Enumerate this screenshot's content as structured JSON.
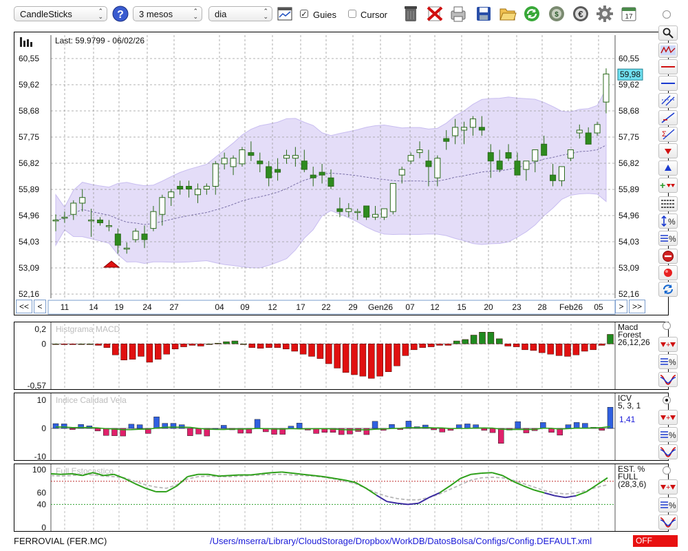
{
  "toolbar": {
    "chart_type": "CandleSticks",
    "period": "3 mesos",
    "interval": "dia",
    "guies_label": "Guies",
    "guies_checked": true,
    "cursor_label": "Cursor",
    "cursor_checked": false,
    "icons": [
      "help-icon",
      "grid-icon",
      "trash-icon",
      "delete-icon",
      "print-icon",
      "save-icon",
      "open-folder-icon",
      "refresh-icon",
      "money-icon",
      "euro-icon",
      "settings-icon",
      "calendar-icon"
    ],
    "calendar_day": "17"
  },
  "main_chart": {
    "last_label": "Last: 59.9799 - 06/02/26",
    "last_price": "59,98",
    "y_ticks": [
      "60,55",
      "59,62",
      "58,68",
      "57,75",
      "56,82",
      "55,89",
      "54,96",
      "54,03",
      "53,09",
      "52,16"
    ],
    "x_ticks": [
      "11",
      "14",
      "19",
      "24",
      "27",
      "04",
      "09",
      "12",
      "17",
      "22",
      "29",
      "Gen26",
      "07",
      "12",
      "15",
      "20",
      "23",
      "28",
      "Feb26",
      "05"
    ],
    "nav": {
      "first": "<<",
      "prev": "<",
      "next": ">",
      "last": ">>"
    }
  },
  "macd": {
    "title": "Histgrama MACD",
    "y_ticks": [
      "0,2",
      "0",
      "-0,57"
    ],
    "label_lines": [
      "Macd",
      "Forest",
      "26,12,26"
    ]
  },
  "icv": {
    "title": "Indice Calidad Vela",
    "y_ticks": [
      "10",
      "0",
      "-10"
    ],
    "label_lines": [
      "ICV",
      "5, 3, 1"
    ],
    "value": "1,41"
  },
  "stoch": {
    "title": "Full Estocastico",
    "y_ticks": [
      "100",
      "60",
      "40",
      "0"
    ],
    "label_lines": [
      "EST. %",
      "FULL",
      "(28,3,6)"
    ]
  },
  "status": {
    "ticker": "FERROVIAL (FER.MC)",
    "config_path": "/Users/mserra/Library/CloudStorage/Dropbox/WorkDB/DatosBolsa/Configs/Config.DEFAULT.xml",
    "state": "OFF"
  },
  "colors": {
    "up_candle": "#2e8b1e",
    "down_candle": "#2e8b1e",
    "band_fill": "#e4ddf8",
    "macd_bar": "#e01010",
    "macd_pos": "#208a20",
    "icv_pos": "#3060e0",
    "icv_neg": "#e0206a",
    "line_green": "#2ea01a",
    "line_blue": "#3a2aa0",
    "line_gray": "#b8b8b8",
    "status_off": "#e81010"
  },
  "chart_data": [
    {
      "type": "candlestick",
      "ylim": [
        52.16,
        60.55
      ],
      "candles": [
        [
          54.8,
          55.0,
          54.4,
          54.8
        ],
        [
          54.9,
          55.1,
          54.7,
          54.9
        ],
        [
          55.0,
          55.5,
          54.8,
          55.4
        ],
        [
          55.4,
          55.9,
          55.1,
          55.6
        ],
        [
          54.8,
          55.2,
          54.2,
          54.8
        ],
        [
          54.8,
          54.9,
          54.6,
          54.7
        ],
        [
          54.6,
          54.8,
          54.4,
          54.6
        ],
        [
          54.3,
          54.5,
          53.6,
          53.9
        ],
        [
          53.8,
          54.0,
          53.6,
          53.8
        ],
        [
          54.1,
          54.5,
          54.0,
          54.4
        ],
        [
          54.3,
          54.6,
          53.8,
          54.1
        ],
        [
          54.5,
          55.3,
          54.4,
          55.1
        ],
        [
          55.0,
          55.7,
          54.6,
          55.6
        ],
        [
          55.6,
          55.9,
          55.3,
          55.8
        ],
        [
          56.0,
          56.2,
          55.7,
          55.9
        ],
        [
          56.0,
          56.2,
          55.6,
          55.9
        ],
        [
          55.7,
          56.1,
          55.4,
          55.9
        ],
        [
          55.9,
          56.1,
          55.7,
          56.0
        ],
        [
          56.0,
          56.9,
          55.7,
          56.8
        ],
        [
          56.8,
          57.2,
          56.6,
          57.0
        ],
        [
          56.7,
          57.1,
          56.4,
          57.0
        ],
        [
          56.8,
          57.4,
          56.7,
          57.3
        ],
        [
          57.2,
          57.6,
          56.9,
          57.1
        ],
        [
          56.9,
          57.2,
          56.5,
          56.8
        ],
        [
          56.7,
          56.9,
          56.0,
          56.3
        ],
        [
          56.6,
          57.0,
          56.2,
          56.5
        ],
        [
          57.0,
          57.3,
          56.8,
          57.1
        ],
        [
          57.0,
          57.4,
          56.7,
          57.1
        ],
        [
          56.9,
          57.3,
          56.5,
          56.6
        ],
        [
          56.4,
          56.7,
          56.0,
          56.3
        ],
        [
          56.5,
          56.8,
          56.1,
          56.4
        ],
        [
          56.3,
          56.6,
          55.9,
          56.0
        ],
        [
          55.2,
          55.6,
          54.9,
          55.1
        ],
        [
          55.1,
          55.4,
          54.9,
          55.2
        ],
        [
          55.1,
          55.2,
          54.8,
          55.1
        ],
        [
          55.3,
          55.3,
          54.8,
          54.9
        ],
        [
          54.9,
          55.3,
          54.8,
          55.0
        ],
        [
          54.9,
          55.2,
          54.8,
          55.2
        ],
        [
          55.1,
          56.0,
          55.0,
          56.1
        ],
        [
          56.4,
          56.7,
          56.1,
          56.6
        ],
        [
          56.9,
          57.2,
          56.8,
          57.1
        ],
        [
          57.2,
          57.6,
          57.0,
          57.3
        ],
        [
          56.9,
          57.3,
          56.0,
          56.7
        ],
        [
          56.3,
          57.1,
          56.0,
          57.0
        ],
        [
          57.7,
          58.0,
          57.3,
          57.6
        ],
        [
          57.8,
          58.4,
          57.5,
          58.1
        ],
        [
          58.0,
          58.3,
          57.5,
          58.1
        ],
        [
          58.1,
          58.5,
          57.8,
          58.4
        ],
        [
          58.1,
          58.5,
          57.8,
          58.0
        ],
        [
          57.2,
          57.5,
          56.3,
          56.9
        ],
        [
          56.9,
          57.3,
          56.5,
          56.6
        ],
        [
          57.2,
          57.5,
          56.9,
          57.0
        ],
        [
          56.9,
          57.2,
          56.5,
          56.4
        ],
        [
          56.6,
          56.9,
          56.2,
          56.9
        ],
        [
          56.9,
          57.2,
          56.5,
          57.3
        ],
        [
          57.5,
          57.8,
          57.1,
          57.1
        ],
        [
          56.4,
          56.8,
          56.0,
          56.2
        ],
        [
          56.2,
          56.6,
          56.0,
          56.7
        ],
        [
          57.0,
          57.3,
          56.9,
          57.3
        ],
        [
          57.9,
          58.2,
          57.7,
          58.0
        ],
        [
          57.9,
          58.1,
          57.5,
          57.5
        ],
        [
          57.9,
          58.3,
          57.8,
          58.2
        ],
        [
          59.0,
          60.2,
          58.6,
          60.0
        ]
      ]
    },
    {
      "type": "bar",
      "ylim": [
        -0.57,
        0.2
      ],
      "values": [
        0,
        -0.01,
        -0.01,
        0,
        0,
        -0.02,
        -0.05,
        -0.15,
        -0.22,
        -0.21,
        -0.17,
        -0.25,
        -0.21,
        -0.14,
        -0.07,
        -0.04,
        -0.02,
        -0.03,
        0,
        0.01,
        0.03,
        0.04,
        0,
        -0.05,
        -0.06,
        -0.05,
        -0.05,
        -0.07,
        -0.1,
        -0.14,
        -0.17,
        -0.2,
        -0.27,
        -0.33,
        -0.39,
        -0.42,
        -0.44,
        -0.47,
        -0.44,
        -0.38,
        -0.3,
        -0.16,
        -0.08,
        -0.05,
        -0.04,
        -0.02,
        -0.02,
        0.04,
        0.06,
        0.12,
        0.16,
        0.16,
        0.07,
        -0.03,
        -0.04,
        -0.08,
        -0.09,
        -0.12,
        -0.14,
        -0.16,
        -0.17,
        -0.15,
        -0.1,
        -0.08,
        -0.02,
        0.13
      ]
    },
    {
      "type": "bar",
      "ylim": [
        -10,
        10
      ],
      "values": [
        1.7,
        1.6,
        -0.4,
        1.4,
        0.9,
        -0.9,
        -2.5,
        -2.6,
        -2.7,
        1.5,
        1.3,
        -1.8,
        4.1,
        1.8,
        1.8,
        1.3,
        -2.6,
        -2.0,
        -2.7,
        0,
        1.1,
        -0.5,
        -1.7,
        -1.7,
        3.2,
        -1.2,
        -2.1,
        -2.1,
        0.8,
        1.9,
        -0.6,
        -1.8,
        -1.4,
        -1.4,
        -2.2,
        -2.0,
        -1.1,
        -2.2,
        2.5,
        -0.7,
        1.4,
        -0.4,
        2.6,
        0.6,
        1.2,
        -0.5,
        -1.3,
        -0.7,
        1.3,
        1.6,
        1.3,
        -0.7,
        -1.5,
        -5.3,
        -0.6,
        2.4,
        -1.6,
        -0.8,
        2.1,
        -1.4,
        -2.4,
        1.3,
        2.1,
        1.8,
        0.4,
        -0.7,
        7.5
      ],
      "signal_value": 1.41
    },
    {
      "type": "line",
      "ylim": [
        0,
        100
      ],
      "series": [
        {
          "values": [
            93,
            92,
            93,
            90,
            95,
            90,
            92,
            85,
            76,
            68,
            62,
            62,
            72,
            88,
            92,
            92,
            89,
            90,
            91,
            91,
            93,
            95,
            96,
            94,
            92,
            90,
            88,
            85,
            82,
            78,
            68,
            56,
            45,
            42,
            40,
            42,
            52,
            60,
            72,
            85,
            92,
            94,
            95,
            90,
            80,
            72,
            65,
            60,
            55,
            52,
            55,
            62,
            74,
            86
          ]
        },
        {
          "values": [
            90,
            89,
            90,
            92,
            91,
            89,
            88,
            86,
            80,
            74,
            70,
            68,
            74,
            84,
            88,
            89,
            88,
            88,
            89,
            90,
            91,
            92,
            92,
            91,
            90,
            89,
            87,
            84,
            80,
            76,
            68,
            60,
            54,
            50,
            48,
            48,
            52,
            58,
            66,
            74,
            82,
            86,
            87,
            86,
            82,
            76,
            70,
            64,
            60,
            58,
            60,
            64,
            70,
            74
          ]
        }
      ],
      "ref_lines": [
        80,
        40
      ]
    }
  ]
}
